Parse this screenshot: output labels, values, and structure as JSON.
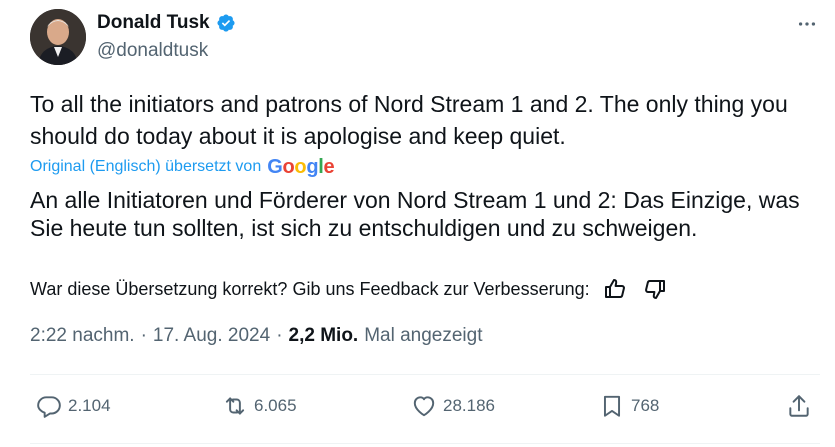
{
  "author": {
    "display_name": "Donald Tusk",
    "handle": "@donaldtusk",
    "verified_icon": "verified-badge-icon"
  },
  "tweet": {
    "text": "To all the initiators and patrons of Nord Stream 1 and 2. The only thing you should do today about it is apologise and keep quiet.",
    "translation_label": "Original (Englisch) übersetzt von",
    "translation_provider": "Google",
    "translated_text": "An alle Initiatoren und Förderer von Nord Stream 1 und 2: Das Einzige, was Sie heute tun sollten, ist sich zu entschuldigen und zu schweigen.",
    "feedback_prompt": "War diese Übersetzung korrekt? Gib uns Feedback zur Verbesserung:"
  },
  "meta": {
    "time": "2:22 nachm.",
    "separator1": "·",
    "date": "17. Aug. 2024",
    "separator2": "·",
    "views": "2,2 Mio.",
    "views_label": "Mal angezeigt"
  },
  "actions": {
    "replies": "2.104",
    "reposts": "6.065",
    "likes": "28.186",
    "bookmarks": "768"
  },
  "colors": {
    "accent": "#1d9bf0",
    "secondary_text": "#536471",
    "primary_text": "#0f1419"
  }
}
